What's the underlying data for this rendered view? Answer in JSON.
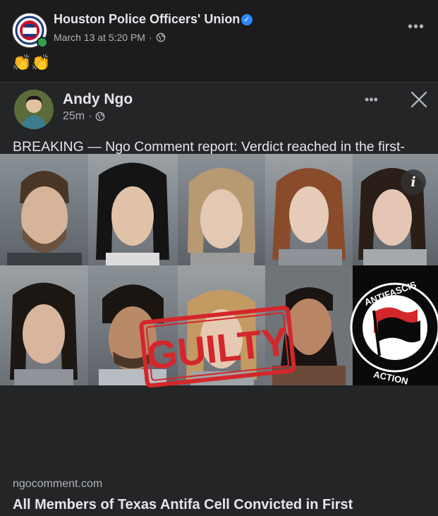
{
  "post": {
    "page_name": "Houston Police Officers' Union",
    "timestamp": "March 13 at 5:20 PM",
    "audience_separator": "·",
    "text": "👏👏"
  },
  "shared": {
    "author": "Andy Ngo",
    "time": "25m",
    "separator": "·",
    "body": "BREAKING — Ngo Comment report: Verdict reached in the first-ever federal Antifa terrorism trial over the Texas ICE ambush where an officer was shot in the neck. All cell members have been CONVICTED. Antifa supporters had threatened witnesses during the trial."
  },
  "photo": {
    "stamp_text": "GUILTY",
    "logo_text_top": "ANTIFASCIS",
    "logo_text_bottom": "ACTION",
    "info_label": "i"
  },
  "link": {
    "domain": "ngocomment.com",
    "title": "All Members of Texas Antifa Cell Convicted in First"
  },
  "icons": {
    "verified": "✓",
    "more": "•••",
    "close": "close-icon",
    "globe": "globe-icon"
  },
  "colors": {
    "background": "#1c1c1d",
    "card": "#242526",
    "verified_blue": "#2d88ff",
    "stamp_red": "#d4272b",
    "online_green": "#31a24c"
  }
}
